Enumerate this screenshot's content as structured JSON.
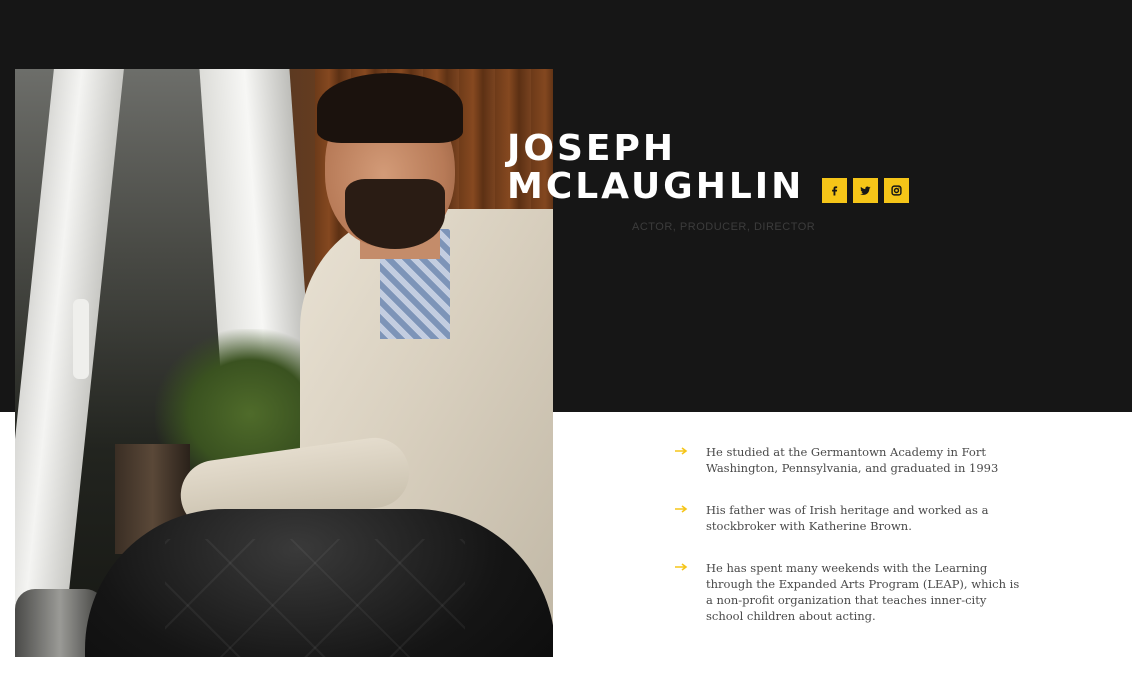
{
  "profile": {
    "first_name": "JOSEPH",
    "last_name": "MCLAUGHLIN",
    "roles": "ACTOR,  PRODUCER,  DIRECTOR"
  },
  "social": [
    {
      "network": "facebook",
      "icon": "facebook-icon",
      "glyph": "f"
    },
    {
      "network": "twitter",
      "icon": "twitter-icon"
    },
    {
      "network": "instagram",
      "icon": "instagram-icon"
    }
  ],
  "facts": [
    {
      "icon": "arrow-right-icon",
      "text": "He studied at the Germantown Academy in Fort Washington, Pennsylvania, and graduated in 1993"
    },
    {
      "icon": "arrow-right-icon",
      "text": "His father was of Irish heritage and worked as a stockbroker with Katherine Brown."
    },
    {
      "icon": "arrow-right-icon",
      "text": "He has spent many weekends with the Learning through the Expanded Arts Program (LEAP), which is a non-profit organization that teaches inner-city school children about acting."
    }
  ],
  "colors": {
    "accent": "#f5c518",
    "dark_background": "#161616",
    "light_background": "#ffffff",
    "heading_text": "#ffffff",
    "body_text": "#4a4a4a"
  }
}
